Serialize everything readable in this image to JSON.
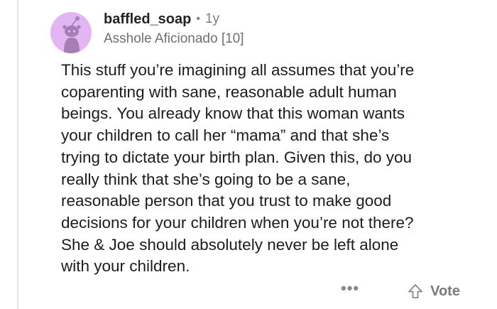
{
  "comment": {
    "username": "baffled_soap",
    "separator": "•",
    "age": "1y",
    "flair": "Asshole Aficionado [10]",
    "body_lines": [
      "This stuff you’re imagining all assumes that you’re",
      "coparenting with sane, reasonable adult human",
      "beings. You already know that this woman wants",
      "your children to call her “mama” and that she’s",
      "trying to dictate your birth plan. Given this, do you",
      "really think that she’s going to be a sane,",
      "reasonable person that you trust to make good",
      "decisions for your children when you’re not there?",
      "She & Joe should absolutely never be left alone",
      "with your children."
    ]
  },
  "actions": {
    "more_label": "•••",
    "vote_label": "Vote",
    "vote_icon": "upvote-arrow-icon"
  },
  "colors": {
    "avatar_bg": "#e4b5f3",
    "avatar_figure": "#a57fb3",
    "meta_gray": "#7c7c7c",
    "text": "#1c1c1c"
  }
}
